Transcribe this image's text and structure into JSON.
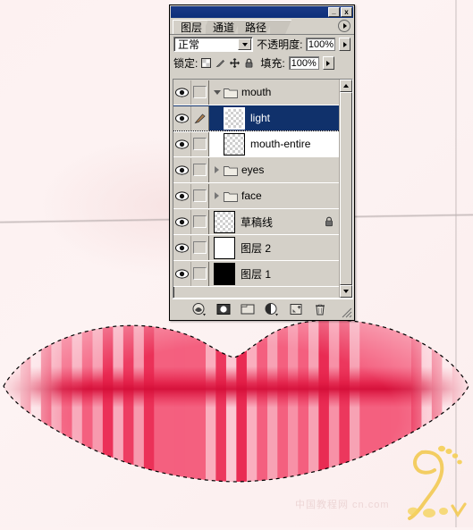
{
  "app": {
    "background_color": "#fdf2f2",
    "accent_selected": "#10316b",
    "panel_face": "#d4d0c8"
  },
  "panel": {
    "titlebar": {
      "minimize_label": "_",
      "close_label": "x",
      "minimize_icon": "minimize-icon",
      "close_icon": "close-icon"
    },
    "tabs": [
      {
        "label": "图层",
        "active": true
      },
      {
        "label": "通道",
        "active": false
      },
      {
        "label": "路径",
        "active": false
      }
    ],
    "menu_icon": "panel-menu-icon",
    "blend": {
      "mode_value": "正常",
      "opacity_label": "不透明度:",
      "opacity_value": "100%"
    },
    "lock": {
      "label": "锁定:",
      "icons": [
        "lock-transparency-icon",
        "lock-image-icon",
        "lock-position-icon",
        "lock-all-icon"
      ],
      "fill_label": "填充:",
      "fill_value": "100%"
    },
    "layers": [
      {
        "name": "mouth",
        "type": "group",
        "expanded": true,
        "visible": true,
        "selected": false,
        "indent": 0,
        "thumb": "none",
        "locked": false,
        "brush": false
      },
      {
        "name": "light",
        "type": "layer",
        "visible": true,
        "selected": true,
        "indent": 1,
        "thumb": "checker",
        "locked": false,
        "brush": true
      },
      {
        "name": "mouth-entire",
        "type": "layer",
        "visible": true,
        "selected": false,
        "indent": 1,
        "thumb": "checker-mark",
        "locked": false,
        "brush": false,
        "white_bg": true
      },
      {
        "name": "eyes",
        "type": "group",
        "expanded": false,
        "visible": true,
        "selected": false,
        "indent": 0,
        "thumb": "none",
        "locked": false,
        "brush": false
      },
      {
        "name": "face",
        "type": "group",
        "expanded": false,
        "visible": true,
        "selected": false,
        "indent": 0,
        "thumb": "none",
        "locked": false,
        "brush": false
      },
      {
        "name": "草稿线",
        "type": "layer",
        "visible": true,
        "selected": false,
        "indent": 0,
        "thumb": "checker",
        "locked": true,
        "brush": false
      },
      {
        "name": "图层 2",
        "type": "layer",
        "visible": true,
        "selected": false,
        "indent": 0,
        "thumb": "white",
        "locked": false,
        "brush": false
      },
      {
        "name": "图层 1",
        "type": "layer",
        "visible": true,
        "selected": false,
        "indent": 0,
        "thumb": "black",
        "locked": false,
        "brush": false
      }
    ],
    "scrollbar": {
      "up_icon": "scroll-up-icon",
      "down_icon": "scroll-down-icon"
    },
    "footer_buttons": [
      "layer-style-icon",
      "layer-mask-icon",
      "new-group-icon",
      "adjustment-layer-icon",
      "new-layer-icon",
      "delete-layer-icon"
    ]
  },
  "artwork": {
    "name": "striped-lips-illustration",
    "selection_marching_ants": true,
    "colors": {
      "lip_base": "#f4607f",
      "lip_deep": "#e8264f",
      "lip_light": "#f8b3c2",
      "lip_pale": "#fde2e8",
      "mouth_line": "#e01a43"
    },
    "stripe_count": 46
  },
  "watermark": {
    "logo_name": "yellow-footprint-logo",
    "text": "中国教程网 cn.com"
  }
}
